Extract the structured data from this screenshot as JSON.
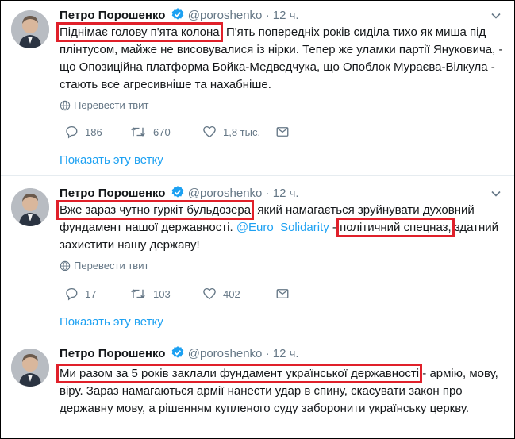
{
  "tweets": [
    {
      "name": "Петро Порошенко",
      "handle": "@poroshenko",
      "dot": "·",
      "time": "12 ч.",
      "hl1": "Піднімає голову п'ята колона",
      "t1": ". П'ять попередніх років сиділа тихо як миша під плінтусом, майже не висовувалися із нірки. Тепер же уламки партії Януковича, - що Опозиційна платформа Бойка-Медведчука, що Опоблок Мураєва-Вілкула - стають все агресивніше та нахабніше.",
      "translate": "Перевести твит",
      "replies": "186",
      "retweets": "670",
      "likes": "1,8 тыс.",
      "thread": "Показать эту ветку"
    },
    {
      "name": "Петро Порошенко",
      "handle": "@poroshenko",
      "dot": "·",
      "time": "12 ч.",
      "hl1": "Вже зараз чутно гуркіт бульдозера",
      "t1": ", який намагається зруйнувати духовний фундамент нашої державності. ",
      "mention": "@Euro_Solidarity",
      "t2": " - ",
      "hl2": "політичний спецназ,",
      "t3": " здатний захистити нашу державу!",
      "translate": "Перевести твит",
      "replies": "17",
      "retweets": "103",
      "likes": "402",
      "thread": "Показать эту ветку"
    },
    {
      "name": "Петро Порошенко",
      "handle": "@poroshenko",
      "dot": "·",
      "time": "12 ч.",
      "hl1": "Ми разом за 5 років заклали фундамент української державності",
      "t1": " - армію, мову, віру. Зараз намагаються армії нанести удар в спину, скасувати закон про державну мову, а рішенням купленого суду заборонити українську церкву."
    }
  ],
  "colors": {
    "link": "#1da1f2",
    "muted": "#657786",
    "highlight": "#e0202a",
    "verified": "#1da1f2"
  },
  "icons": [
    "avatar",
    "verified-badge-icon",
    "chevron-down-icon",
    "globe-icon",
    "reply-icon",
    "retweet-icon",
    "like-icon",
    "direct-message-icon"
  ]
}
